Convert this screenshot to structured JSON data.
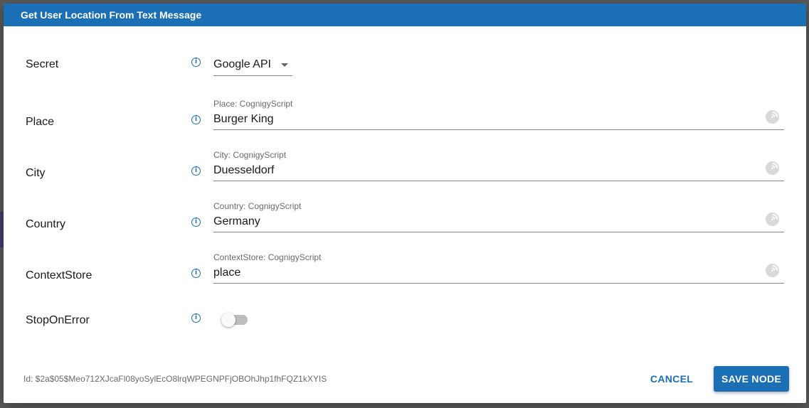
{
  "dialog": {
    "title": "Get User Location From Text Message"
  },
  "fields": {
    "secret": {
      "label": "Secret",
      "value": "Google API"
    },
    "place": {
      "label": "Place",
      "floating_label": "Place: CognigyScript",
      "value": "Burger King"
    },
    "city": {
      "label": "City",
      "floating_label": "City: CognigyScript",
      "value": "Duesseldorf"
    },
    "country": {
      "label": "Country",
      "floating_label": "Country: CognigyScript",
      "value": "Germany"
    },
    "context_store": {
      "label": "ContextStore",
      "floating_label": "ContextStore: CognigyScript",
      "value": "place"
    },
    "stop_on_error": {
      "label": "StopOnError",
      "enabled": false
    }
  },
  "footer": {
    "node_id": "Id: $2a$05$Meo712XJcaFl08yoSylEcO8lrqWPEGNPFjOBOhJhp1fhFQZ1kXYIS",
    "cancel_label": "CANCEL",
    "save_label": "SAVE NODE"
  },
  "icons": {
    "info": "info-icon",
    "script": "cognigy-script-icon"
  },
  "colors": {
    "primary": "#1b6fb5",
    "header_text": "#ffffff",
    "toggle_off": "#bdbdbd"
  }
}
